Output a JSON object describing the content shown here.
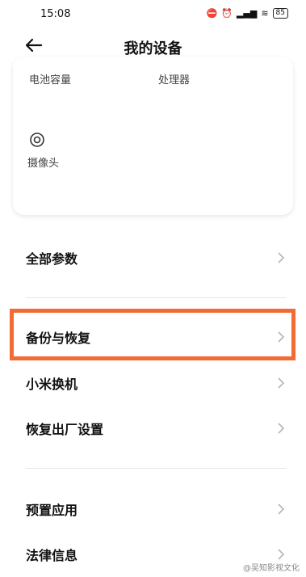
{
  "status_bar": {
    "time": "15:08",
    "battery": "85"
  },
  "header": {
    "title": "我的设备"
  },
  "card": {
    "battery_label": "电池容量",
    "processor_label": "处理器",
    "camera_label": "摄像头"
  },
  "list": {
    "all_params": "全部参数",
    "backup_restore": "备份与恢复",
    "mi_mover": "小米换机",
    "factory_reset": "恢复出厂设置",
    "preinstalled_apps": "预置应用",
    "legal_info": "法律信息"
  },
  "highlight_color": "#f26a34",
  "watermark": "@吴知影视文化"
}
